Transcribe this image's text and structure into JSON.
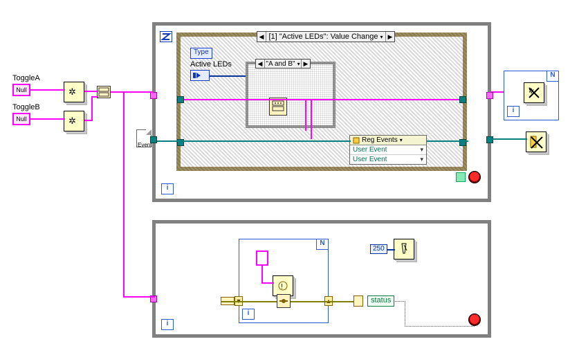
{
  "left_controls": {
    "toggleA": {
      "label": "ToggleA",
      "value": "Null"
    },
    "toggleB": {
      "label": "ToggleB",
      "value": "Null"
    }
  },
  "upper_loop": {
    "event_case": {
      "selector": "[1] \"Active LEDs\": Value Change",
      "type_tag": "Type",
      "active_leds_label": "Active LEDs",
      "inner_case_selector": "\"A and B\""
    },
    "reg_events": {
      "header": "Reg Events",
      "rows": [
        "User Event",
        "User Event"
      ]
    },
    "dyn_event_note": "Event"
  },
  "lower_loop": {
    "wait_ms": "250",
    "status_label": "status"
  },
  "chart_data": {
    "type": "diagram",
    "note": "LabVIEW block diagram — not a quantitative chart",
    "nodes": [
      {
        "id": "toggleA_ctl",
        "kind": "control-ref",
        "label": "ToggleA",
        "value": "Null"
      },
      {
        "id": "toggleB_ctl",
        "kind": "control-ref",
        "label": "ToggleB",
        "value": "Null"
      },
      {
        "id": "create_ue_A",
        "kind": "vi",
        "label": "Create User Event"
      },
      {
        "id": "create_ue_B",
        "kind": "vi",
        "label": "Create User Event"
      },
      {
        "id": "bundle",
        "kind": "bundle"
      },
      {
        "id": "while_upper",
        "kind": "while-loop"
      },
      {
        "id": "event_struct",
        "kind": "event-structure",
        "case": "[1] \"Active LEDs\": Value Change"
      },
      {
        "id": "inner_case",
        "kind": "case-structure",
        "case": "\"A and B\""
      },
      {
        "id": "active_leds_ctl",
        "kind": "control",
        "label": "Active LEDs"
      },
      {
        "id": "build_array",
        "kind": "build-array"
      },
      {
        "id": "reg_events",
        "kind": "register-for-events",
        "rows": [
          "User Event",
          "User Event"
        ]
      },
      {
        "id": "for_right",
        "kind": "for-loop"
      },
      {
        "id": "destroy_ue",
        "kind": "vi",
        "label": "Destroy User Event"
      },
      {
        "id": "unreg_events",
        "kind": "vi",
        "label": "Unregister For Events"
      },
      {
        "id": "while_lower",
        "kind": "while-loop"
      },
      {
        "id": "for_inner_lower",
        "kind": "for-loop"
      },
      {
        "id": "generate_ue",
        "kind": "vi",
        "label": "Generate User Event"
      },
      {
        "id": "merge_err",
        "kind": "merge-errors"
      },
      {
        "id": "unbundle_status",
        "kind": "unbundle-by-name",
        "field": "status"
      },
      {
        "id": "wait",
        "kind": "wait-ms",
        "value": 250
      }
    ],
    "edges": [
      [
        "toggleA_ctl",
        "create_ue_A",
        "ref"
      ],
      [
        "toggleB_ctl",
        "create_ue_B",
        "ref"
      ],
      [
        "create_ue_A",
        "bundle",
        "user-event"
      ],
      [
        "create_ue_B",
        "bundle",
        "user-event"
      ],
      [
        "bundle",
        "while_upper",
        "cluster"
      ],
      [
        "bundle",
        "while_lower",
        "cluster"
      ],
      [
        "while_upper",
        "event_struct",
        "dyn-event"
      ],
      [
        "active_leds_ctl",
        "inner_case",
        "enum"
      ],
      [
        "inner_case",
        "reg_events",
        "user-event[]"
      ],
      [
        "reg_events",
        "event_struct",
        "dyn-event-reg"
      ],
      [
        "while_upper",
        "for_right",
        "user-event[]"
      ],
      [
        "for_right",
        "destroy_ue",
        "user-event"
      ],
      [
        "while_upper",
        "unreg_events",
        "dyn-event-reg"
      ],
      [
        "for_inner_lower",
        "generate_ue",
        "user-event"
      ],
      [
        "generate_ue",
        "merge_err",
        "error"
      ],
      [
        "merge_err",
        "unbundle_status",
        "error"
      ],
      [
        "unbundle_status",
        "while_lower",
        "bool stop"
      ],
      [
        "wait",
        "while_lower",
        "ms"
      ]
    ]
  }
}
